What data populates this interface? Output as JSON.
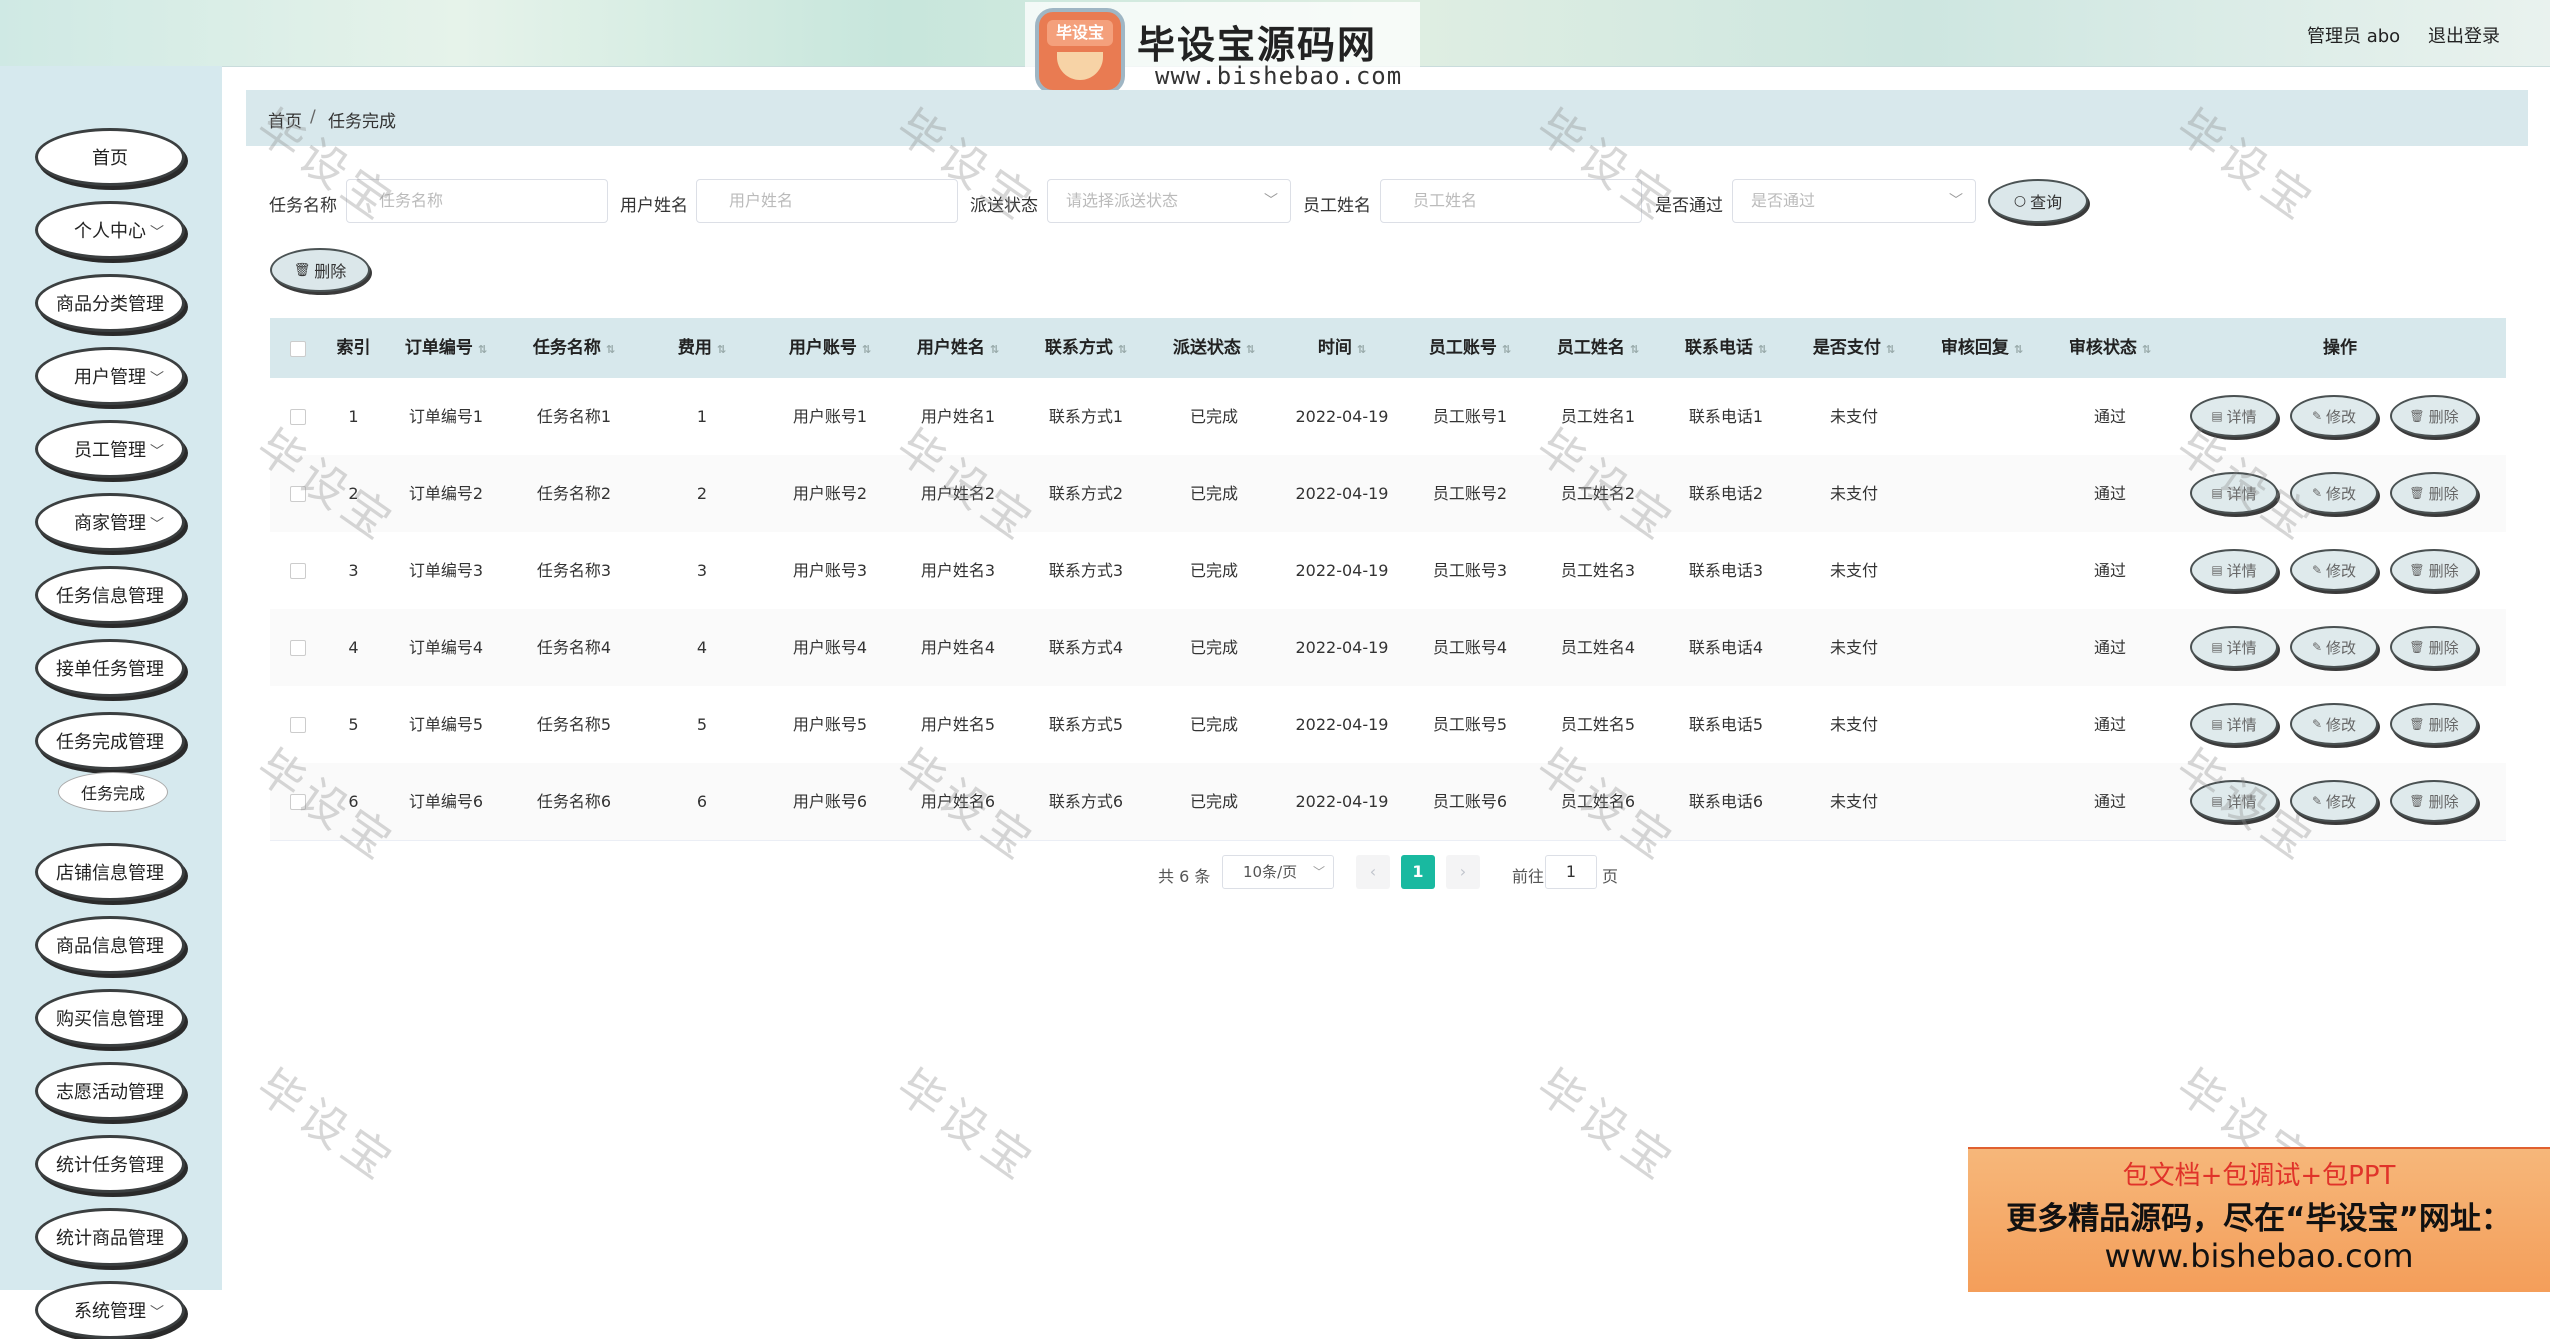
{
  "brand": {
    "badge": "毕设宝",
    "title": "毕设宝源码网",
    "url": "www.bishebao.com"
  },
  "header": {
    "user": "管理员 abo",
    "logout": "退出登录"
  },
  "sidebar": {
    "items": [
      {
        "label": "首页",
        "has_arrow": false
      },
      {
        "label": "个人中心",
        "has_arrow": true
      },
      {
        "label": "商品分类管理",
        "has_arrow": false
      },
      {
        "label": "用户管理",
        "has_arrow": true
      },
      {
        "label": "员工管理",
        "has_arrow": true
      },
      {
        "label": "商家管理",
        "has_arrow": true
      },
      {
        "label": "任务信息管理",
        "has_arrow": false
      },
      {
        "label": "接单任务管理",
        "has_arrow": false
      },
      {
        "label": "任务完成管理",
        "has_arrow": false
      },
      {
        "label": "店铺信息管理",
        "has_arrow": false
      },
      {
        "label": "商品信息管理",
        "has_arrow": false
      },
      {
        "label": "购买信息管理",
        "has_arrow": false
      },
      {
        "label": "志愿活动管理",
        "has_arrow": false
      },
      {
        "label": "统计任务管理",
        "has_arrow": false
      },
      {
        "label": "统计商品管理",
        "has_arrow": false
      },
      {
        "label": "系统管理",
        "has_arrow": true
      }
    ],
    "sub_item": "任务完成"
  },
  "breadcrumb": {
    "home": "首页",
    "sep": "/",
    "current": "任务完成"
  },
  "search": {
    "task_name_label": "任务名称",
    "task_name_placeholder": "任务名称",
    "user_name_label": "用户姓名",
    "user_name_placeholder": "用户姓名",
    "dispatch_label": "派送状态",
    "dispatch_placeholder": "请选择派送状态",
    "staff_name_label": "员工姓名",
    "staff_name_placeholder": "员工姓名",
    "passed_label": "是否通过",
    "passed_placeholder": "是否通过",
    "query_button": "查询",
    "delete_button": "删除"
  },
  "table": {
    "columns": [
      "索引",
      "订单编号",
      "任务名称",
      "费用",
      "用户账号",
      "用户姓名",
      "联系方式",
      "派送状态",
      "时间",
      "员工账号",
      "员工姓名",
      "联系电话",
      "是否支付",
      "审核回复",
      "审核状态",
      "操作"
    ],
    "rows": [
      [
        "1",
        "订单编号1",
        "任务名称1",
        "1",
        "用户账号1",
        "用户姓名1",
        "联系方式1",
        "已完成",
        "2022-04-19",
        "员工账号1",
        "员工姓名1",
        "联系电话1",
        "未支付",
        "",
        "通过"
      ],
      [
        "2",
        "订单编号2",
        "任务名称2",
        "2",
        "用户账号2",
        "用户姓名2",
        "联系方式2",
        "已完成",
        "2022-04-19",
        "员工账号2",
        "员工姓名2",
        "联系电话2",
        "未支付",
        "",
        "通过"
      ],
      [
        "3",
        "订单编号3",
        "任务名称3",
        "3",
        "用户账号3",
        "用户姓名3",
        "联系方式3",
        "已完成",
        "2022-04-19",
        "员工账号3",
        "员工姓名3",
        "联系电话3",
        "未支付",
        "",
        "通过"
      ],
      [
        "4",
        "订单编号4",
        "任务名称4",
        "4",
        "用户账号4",
        "用户姓名4",
        "联系方式4",
        "已完成",
        "2022-04-19",
        "员工账号4",
        "员工姓名4",
        "联系电话4",
        "未支付",
        "",
        "通过"
      ],
      [
        "5",
        "订单编号5",
        "任务名称5",
        "5",
        "用户账号5",
        "用户姓名5",
        "联系方式5",
        "已完成",
        "2022-04-19",
        "员工账号5",
        "员工姓名5",
        "联系电话5",
        "未支付",
        "",
        "通过"
      ],
      [
        "6",
        "订单编号6",
        "任务名称6",
        "6",
        "用户账号6",
        "用户姓名6",
        "联系方式6",
        "已完成",
        "2022-04-19",
        "员工账号6",
        "员工姓名6",
        "联系电话6",
        "未支付",
        "",
        "通过"
      ]
    ],
    "actions": [
      "详情",
      "修改",
      "删除"
    ]
  },
  "pagination": {
    "total": "共 6 条",
    "page_size": "10条/页",
    "prev": "‹",
    "next": "›",
    "current": "1",
    "goto": "前往",
    "goto_value": "1",
    "page_suffix": "页"
  },
  "watermark": "毕设宝",
  "ad": {
    "line1": "包文档+包调试+包PPT",
    "line2": "更多精品源码，尽在“毕设宝”网址：",
    "line3": "www.bishebao.com"
  },
  "colors": {
    "accent": "#19b9a0",
    "header_bg": "#d7e8ec",
    "sidebar_bg": "#d6e9ee",
    "ad_red": "#e0332a"
  }
}
